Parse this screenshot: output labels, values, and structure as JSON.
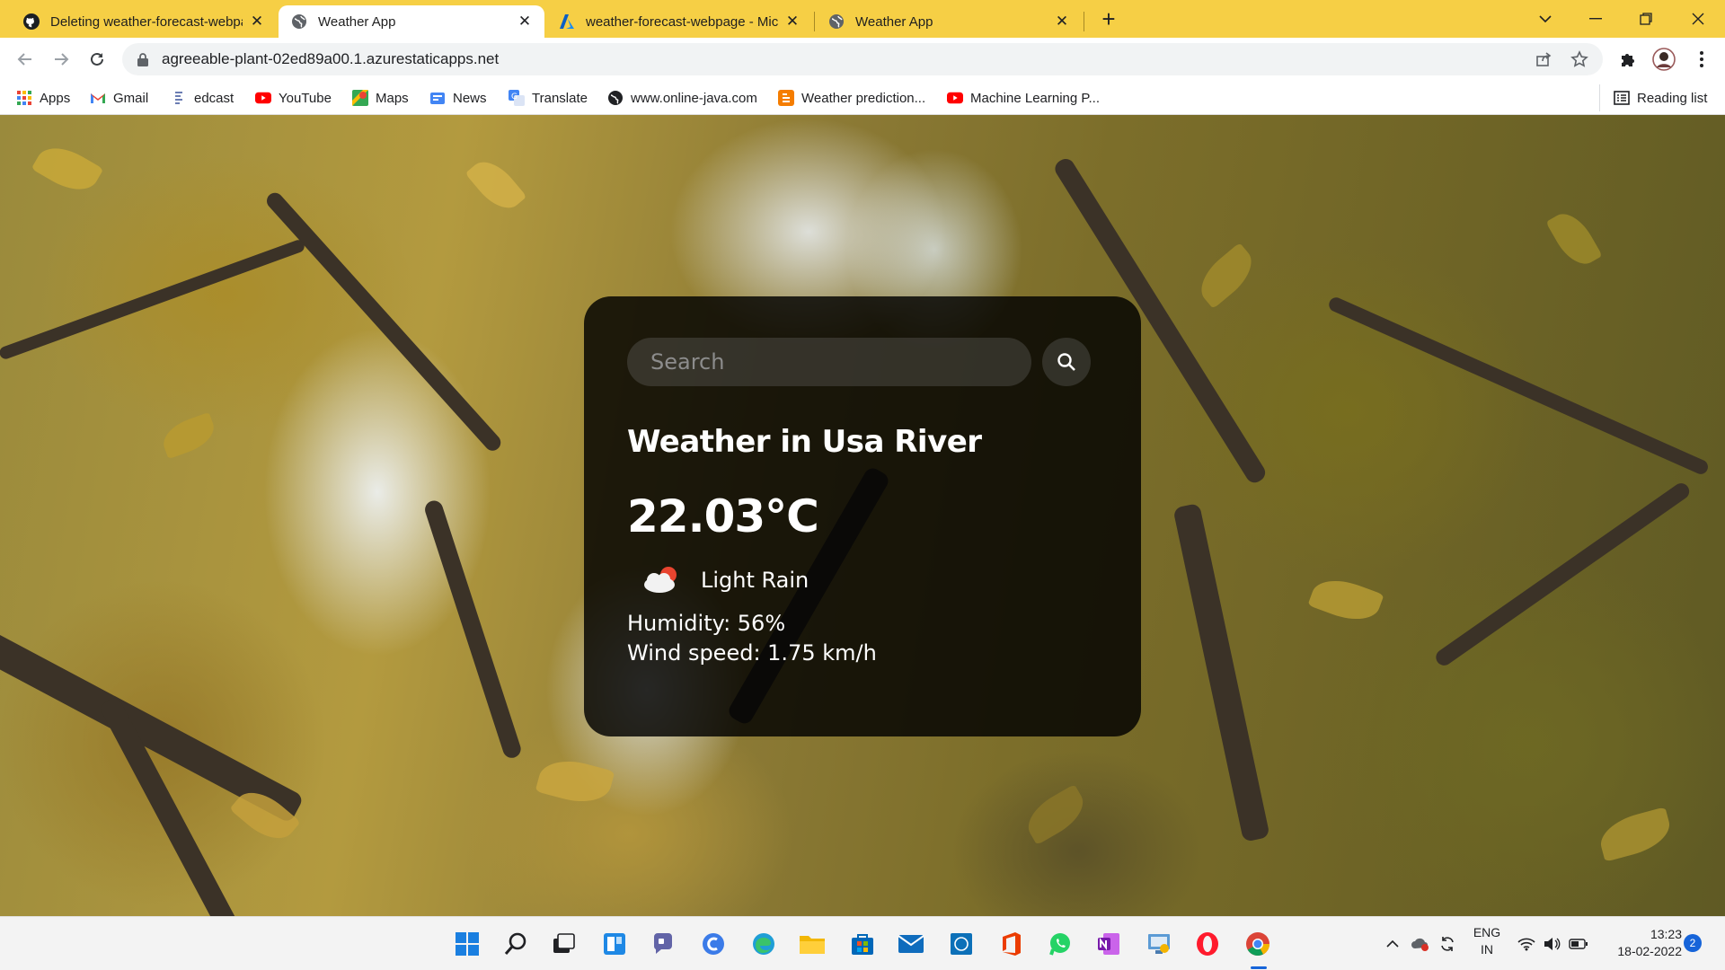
{
  "browser": {
    "tabs": [
      {
        "title": "Deleting weather-forecast-webpa",
        "icon": "github-icon",
        "active": false
      },
      {
        "title": "Weather App",
        "icon": "globe-icon",
        "active": true
      },
      {
        "title": "weather-forecast-webpage - Mic",
        "icon": "azure-icon",
        "active": false
      },
      {
        "title": "Weather App",
        "icon": "globe-icon",
        "active": false
      }
    ],
    "close_glyph": "✕",
    "new_tab_glyph": "+",
    "url": "agreeable-plant-02ed89a00.1.azurestaticapps.net",
    "bookmarks": [
      {
        "label": "Apps",
        "icon": "apps-grid-icon"
      },
      {
        "label": "Gmail",
        "icon": "gmail-icon"
      },
      {
        "label": "edcast",
        "icon": "edcast-icon"
      },
      {
        "label": "YouTube",
        "icon": "youtube-icon"
      },
      {
        "label": "Maps",
        "icon": "maps-icon"
      },
      {
        "label": "News",
        "icon": "news-icon"
      },
      {
        "label": "Translate",
        "icon": "translate-icon"
      },
      {
        "label": "www.online-java.com",
        "icon": "globe-icon"
      },
      {
        "label": "Weather prediction...",
        "icon": "blogger-icon"
      },
      {
        "label": "Machine Learning P...",
        "icon": "youtube-icon"
      }
    ],
    "reading_list": "Reading list"
  },
  "weather": {
    "search_placeholder": "Search",
    "city_line": "Weather in Usa River",
    "temperature": "22.03°C",
    "description": "Light Rain",
    "humidity": "Humidity: 56%",
    "wind": "Wind speed: 1.75 km/h",
    "icon": "cloud-rain-icon"
  },
  "taskbar": {
    "apps": [
      "windows-start-icon",
      "search-icon",
      "task-view-icon",
      "widgets-icon",
      "teams-chat-icon",
      "cortana-icon",
      "edge-icon",
      "file-explorer-icon",
      "microsoft-store-icon",
      "mail-icon",
      "dell-icon",
      "office-icon",
      "whatsapp-icon",
      "onenote-icon",
      "control-panel-icon",
      "opera-icon",
      "chrome-icon"
    ],
    "lang_top": "ENG",
    "lang_bottom": "IN",
    "time": "13:23",
    "date": "18-02-2022",
    "notification_count": "2"
  },
  "colors": {
    "tabstrip": "#f6cf45",
    "card_bg": "#000000",
    "accent_blue": "#1664d9"
  }
}
